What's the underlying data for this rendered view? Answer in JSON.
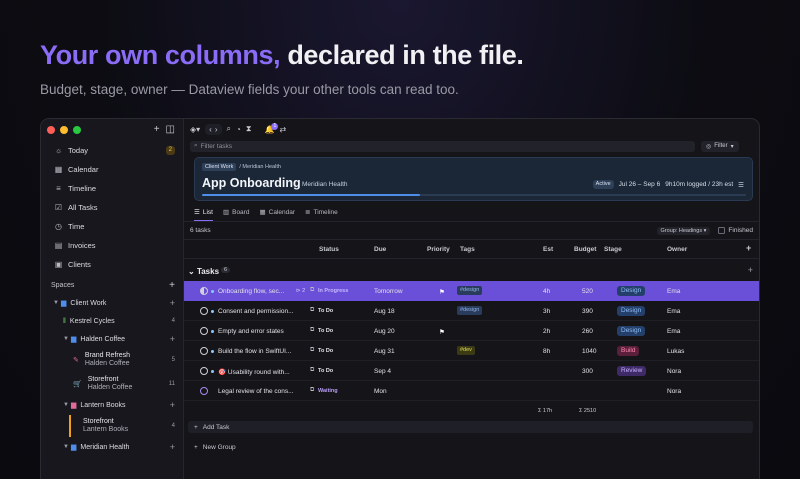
{
  "hero": {
    "title_accent": "Your own columns,",
    "title_rest": " declared in the file.",
    "subtitle": "Budget, stage, owner — Dataview fields your other tools can read too."
  },
  "sidebar": {
    "nav": [
      {
        "label": "Today",
        "icon": "sun-icon",
        "badge": "2"
      },
      {
        "label": "Calendar",
        "icon": "calendar-icon"
      },
      {
        "label": "Timeline",
        "icon": "timeline-icon"
      },
      {
        "label": "All Tasks",
        "icon": "tasks-icon"
      },
      {
        "label": "Time",
        "icon": "clock-icon"
      },
      {
        "label": "Invoices",
        "icon": "invoice-icon"
      },
      {
        "label": "Clients",
        "icon": "clients-icon"
      }
    ],
    "spaces_label": "Spaces",
    "client_work": "Client Work",
    "kestrel": {
      "label": "Kestrel Cycles",
      "count": "4"
    },
    "halden": "Halden Coffee",
    "brand_refresh": {
      "title": "Brand Refresh",
      "sub": "Halden Coffee",
      "count": "5"
    },
    "storefront1": {
      "title": "Storefront",
      "sub": "Halden Coffee",
      "count": "11"
    },
    "lantern": "Lantern Books",
    "storefront2": {
      "title": "Storefront",
      "sub": "Lantern Books",
      "count": "4"
    },
    "meridian": "Meridian Health"
  },
  "toolbar": {
    "filter_placeholder": "Filter tasks",
    "filter_button": "Filter",
    "notif_count": "1"
  },
  "project": {
    "crumb_chip": "Client Work",
    "crumb_rest": "/ Meridian Health",
    "title": "App Onboarding",
    "client": "Meridian Health",
    "status": "Active",
    "dates": "Jul 26 – Sep 6",
    "hours": "9h10m logged / 23h est",
    "progress": 0.4
  },
  "views": [
    "List",
    "Board",
    "Calendar",
    "Timeline"
  ],
  "meta": {
    "count": "6 tasks",
    "group": "Group: Headings",
    "finished": "Finished"
  },
  "columns": {
    "status": "Status",
    "due": "Due",
    "priority": "Priority",
    "tags": "Tags",
    "est": "Est",
    "budget": "Budget",
    "stage": "Stage",
    "owner": "Owner"
  },
  "section": {
    "title": "Tasks",
    "count": "6"
  },
  "rows": [
    {
      "title": "Onboarding flow, sec...",
      "sub": "2",
      "status": "In Progress",
      "due": "Tomorrow",
      "flag": true,
      "tag": "#design",
      "est": "4h",
      "budget": "520",
      "stage": "Design",
      "owner": "Ema"
    },
    {
      "title": "Consent and permission...",
      "status": "To Do",
      "due": "Aug 18",
      "tag": "#design",
      "est": "3h",
      "budget": "390",
      "stage": "Design",
      "owner": "Ema"
    },
    {
      "title": "Empty and error states",
      "status": "To Do",
      "due": "Aug 20",
      "flag": true,
      "est": "2h",
      "budget": "260",
      "stage": "Design",
      "owner": "Ema"
    },
    {
      "title": "Build the flow in SwiftUI...",
      "status": "To Do",
      "due": "Aug 31",
      "tag": "#dev",
      "est": "8h",
      "budget": "1040",
      "stage": "Build",
      "owner": "Lukas"
    },
    {
      "title": "🎯 Usability round with...",
      "status": "To Do",
      "due": "Sep 4",
      "budget": "300",
      "stage": "Review",
      "owner": "Nora"
    },
    {
      "title": "Legal review of the cons...",
      "status": "Waiting",
      "due": "Mon",
      "owner": "Nora"
    }
  ],
  "totals": {
    "est": "Σ 17h",
    "budget": "Σ 2510"
  },
  "add_task": "Add Task",
  "new_group": "New Group",
  "colors": {
    "accent": "#8b6cf6",
    "selected_row": "#6a4fd8",
    "header_card": "#1b2737"
  }
}
